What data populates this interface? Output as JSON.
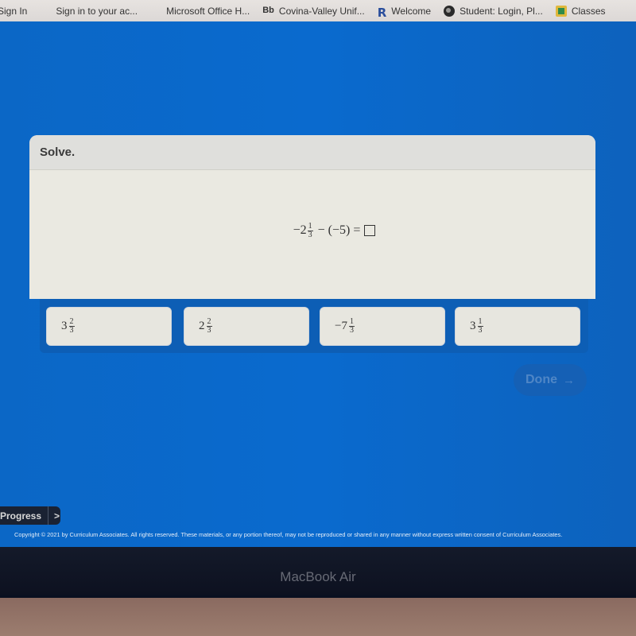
{
  "bookmarks": [
    {
      "label": "Sign In",
      "icon": "none"
    },
    {
      "label": "Sign in to your ac...",
      "icon": "microsoft-icon"
    },
    {
      "label": "Microsoft Office H...",
      "icon": "microsoft-icon"
    },
    {
      "label": "Covina-Valley Unif...",
      "icon": "blackboard-icon",
      "icon_text": "Bb"
    },
    {
      "label": "Welcome",
      "icon": "r-logo-icon",
      "icon_text": "R"
    },
    {
      "label": "Student: Login, Pl...",
      "icon": "globe-icon"
    },
    {
      "label": "Classes",
      "icon": "google-classroom-icon"
    }
  ],
  "question": {
    "header": "Solve.",
    "equation": {
      "sign": "−",
      "whole": "2",
      "numerator": "1",
      "denominator": "3",
      "rest": "− (−5) ="
    }
  },
  "choices": [
    {
      "sign": "",
      "whole": "3",
      "numerator": "2",
      "denominator": "3"
    },
    {
      "sign": "",
      "whole": "2",
      "numerator": "2",
      "denominator": "3"
    },
    {
      "sign": "−",
      "whole": "7",
      "numerator": "1",
      "denominator": "3"
    },
    {
      "sign": "",
      "whole": "3",
      "numerator": "1",
      "denominator": "3"
    }
  ],
  "done_button": {
    "label": "Done",
    "arrow": "→",
    "enabled": false
  },
  "progress": {
    "label": "Progress",
    "chevron": ">"
  },
  "copyright": "Copyright © 2021 by Curriculum Associates. All rights reserved. These materials, or any portion thereof, may not be reproduced or shared in any manner without express written consent of Curriculum Associates.",
  "device": {
    "label": "MacBook Air"
  },
  "colors": {
    "background_blue": "#0a6ace",
    "card": "#eae9e1",
    "done_disabled_text": "#4f86c6"
  }
}
